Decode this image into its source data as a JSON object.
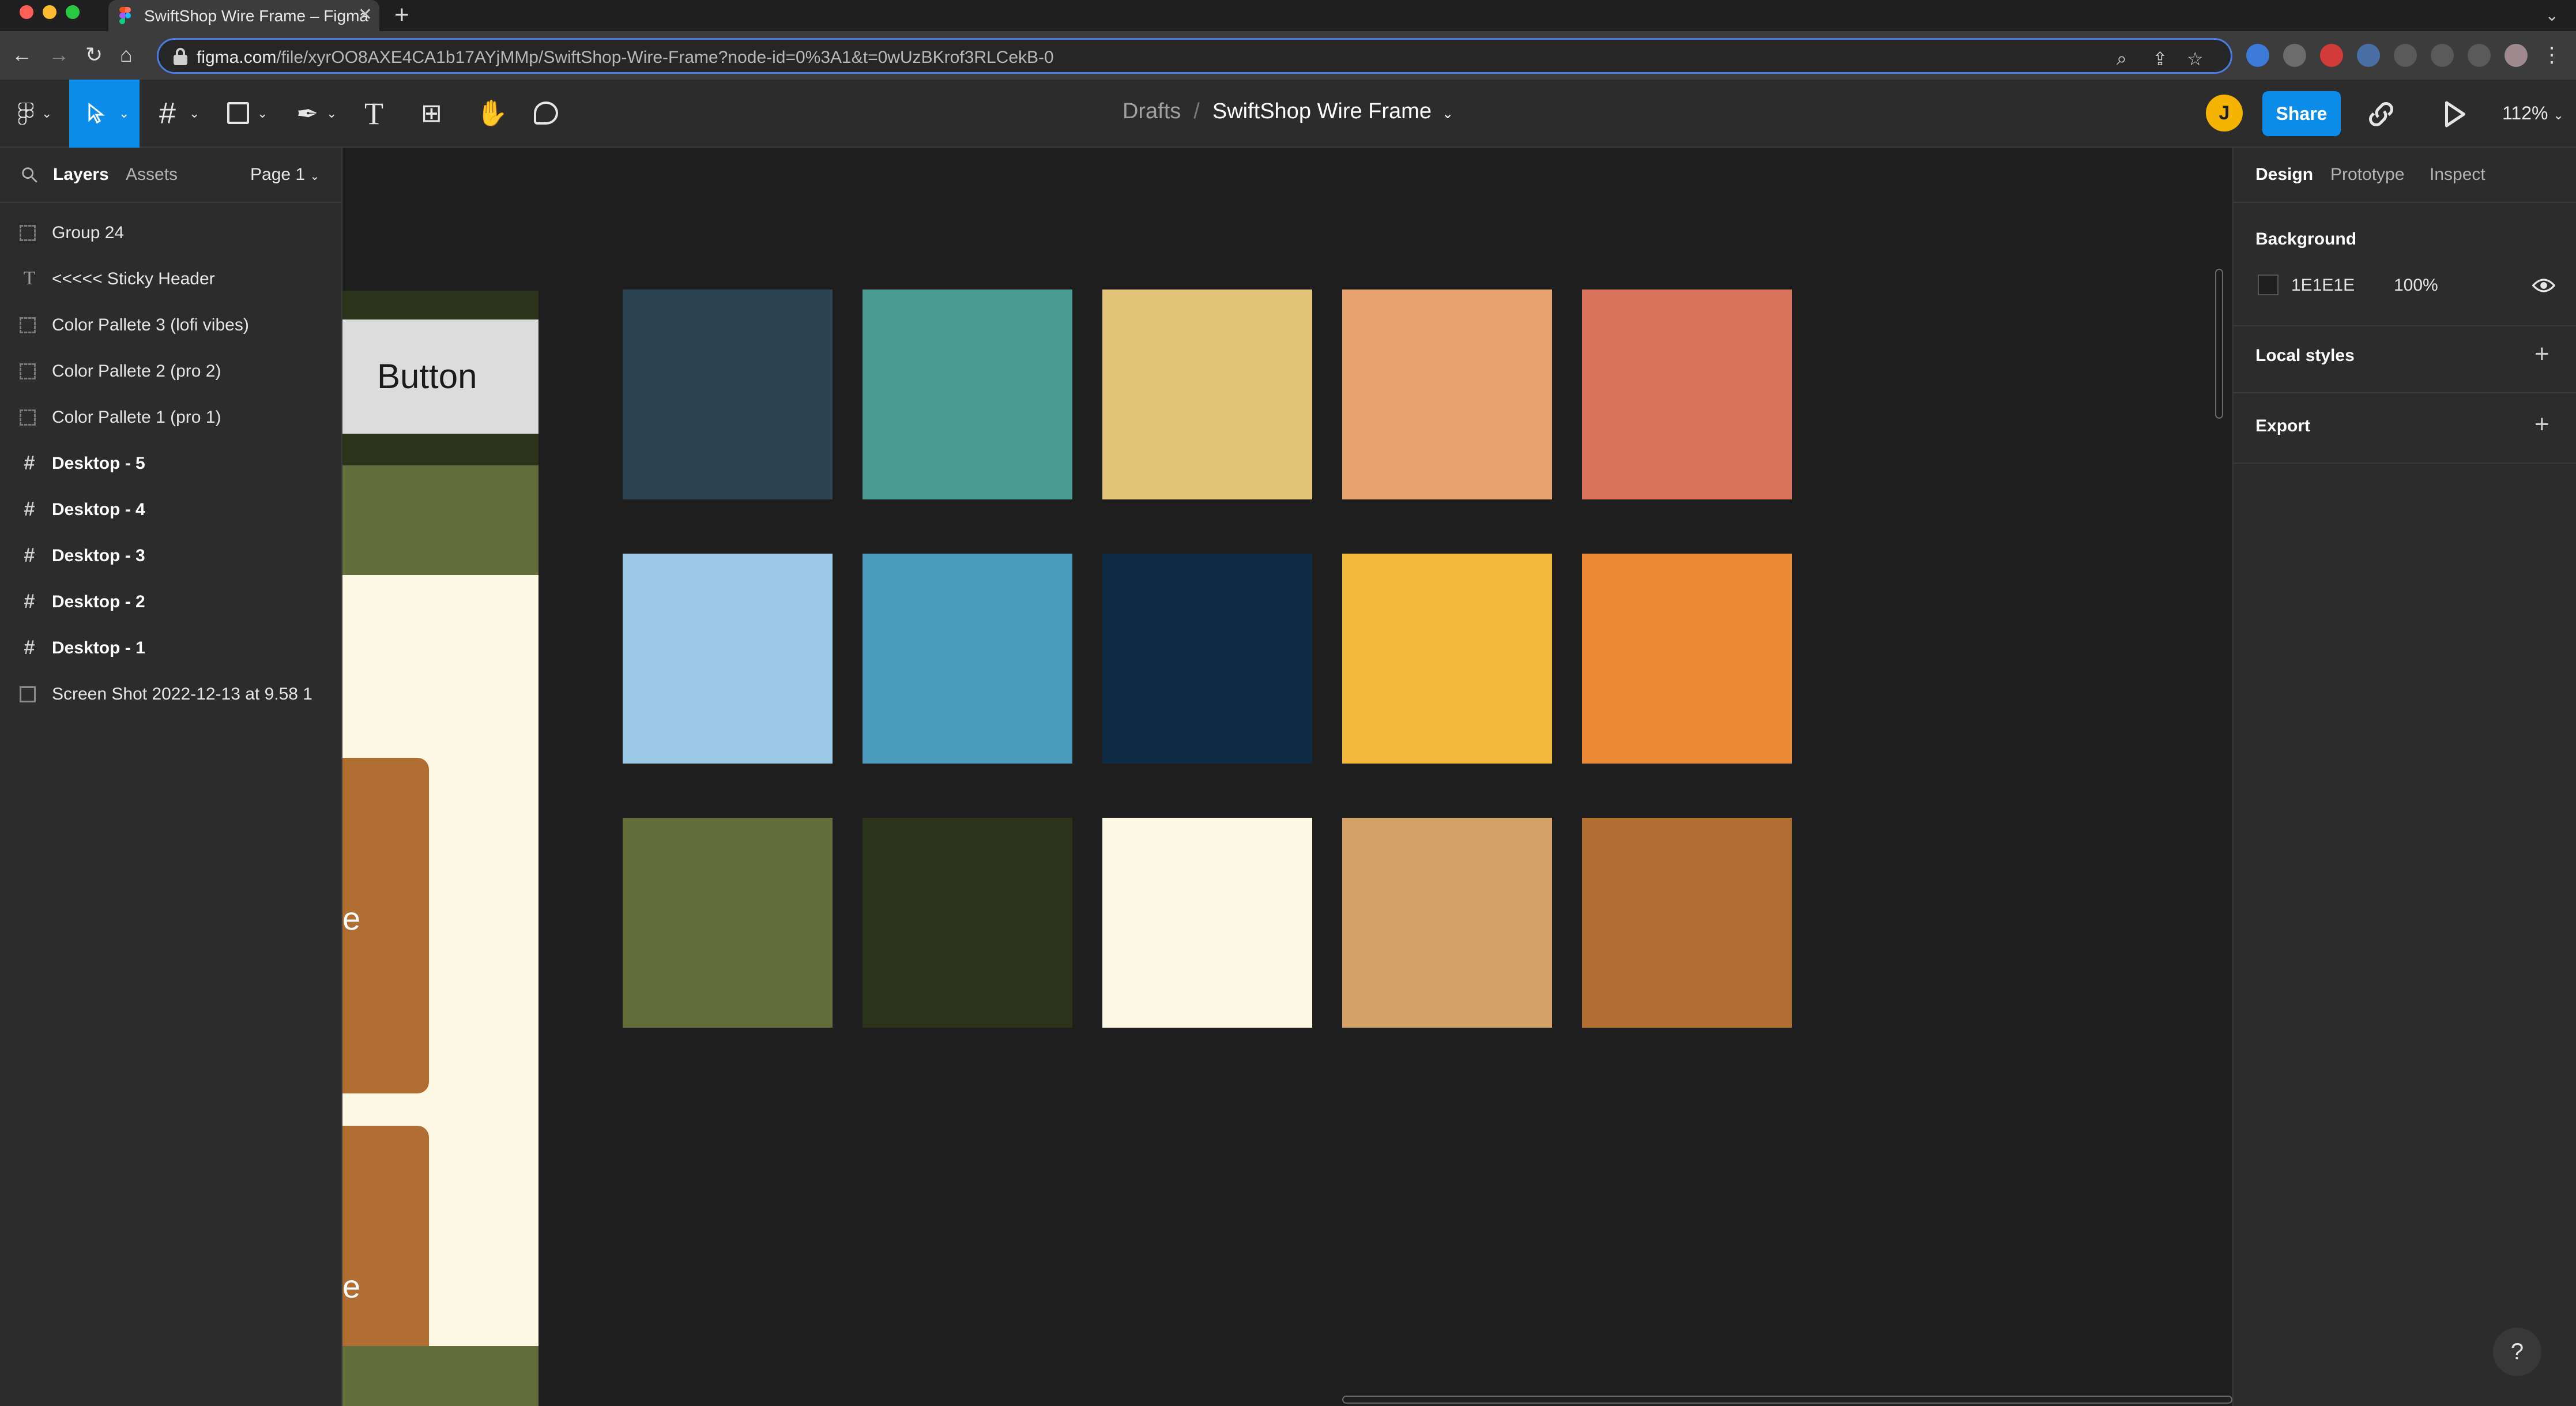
{
  "browser": {
    "tab_title": "SwiftShop Wire Frame – Figma",
    "tab_close": "✕",
    "new_tab": "+",
    "url_domain": "figma.com",
    "url_path": "/file/xyrOO8AXE4CA1b17AYjMMp/SwiftShop-Wire-Frame?node-id=0%3A1&t=0wUzBKrof3RLCekB-0",
    "traffic_light_colors": [
      "#ff5f57",
      "#febc2e",
      "#28c840"
    ]
  },
  "toolbar": {
    "breadcrumb_root": "Drafts",
    "breadcrumb_sep": "/",
    "file_name": "SwiftShop Wire Frame",
    "avatar_initial": "J",
    "share_label": "Share",
    "zoom_label": "112%"
  },
  "left_panel": {
    "tab_layers": "Layers",
    "tab_assets": "Assets",
    "page_label": "Page 1",
    "layers": [
      {
        "name": "Group 24",
        "icon": "group-icon",
        "bold": false
      },
      {
        "name": "<<<<< Sticky Header",
        "icon": "text-icon",
        "bold": false
      },
      {
        "name": "Color Pallete 3 (lofi vibes)",
        "icon": "group-icon",
        "bold": false
      },
      {
        "name": "Color Pallete 2 (pro 2)",
        "icon": "group-icon",
        "bold": false
      },
      {
        "name": "Color Pallete 1 (pro 1)",
        "icon": "group-icon",
        "bold": false
      },
      {
        "name": "Desktop - 5",
        "icon": "frame-icon",
        "bold": true
      },
      {
        "name": "Desktop - 4",
        "icon": "frame-icon",
        "bold": true
      },
      {
        "name": "Desktop - 3",
        "icon": "frame-icon",
        "bold": true
      },
      {
        "name": "Desktop - 2",
        "icon": "frame-icon",
        "bold": true
      },
      {
        "name": "Desktop - 1",
        "icon": "frame-icon",
        "bold": true
      },
      {
        "name": "Screen Shot 2022-12-13 at 9.58 1",
        "icon": "image-icon",
        "bold": false
      }
    ]
  },
  "canvas": {
    "frame_button_label": "Button",
    "card_glyph": "e",
    "swatch_rows": [
      [
        "#2c4452",
        "#4a9b91",
        "#e2c579",
        "#e8a26f",
        "#d9725a"
      ],
      [
        "#9ccae6",
        "#4a9bbc",
        "#0f2b44",
        "#f3b93c",
        "#ec8a35"
      ],
      [
        "#636e3c",
        "#2c331b",
        "#fdf8e4",
        "#d4a268",
        "#b06e33"
      ]
    ]
  },
  "right_panel": {
    "tab_design": "Design",
    "tab_prototype": "Prototype",
    "tab_inspect": "Inspect",
    "background_title": "Background",
    "background_hex": "1E1E1E",
    "background_opacity": "100%",
    "local_styles_title": "Local styles",
    "export_title": "Export",
    "plus": "+"
  },
  "help_label": "?"
}
